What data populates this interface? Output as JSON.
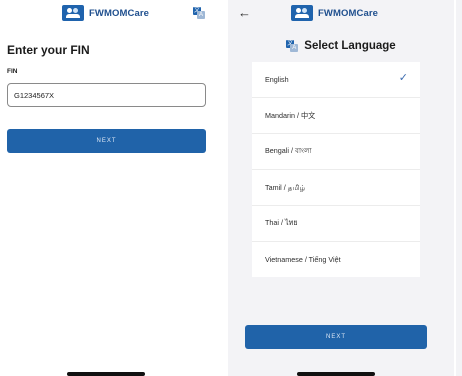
{
  "app": {
    "name": "FWMOMCare"
  },
  "fin_screen": {
    "title": "Enter your FIN",
    "field_label": "FIN",
    "fin_value": "G1234567X",
    "next_label": "NEXT"
  },
  "language_screen": {
    "title": "Select Language",
    "languages": [
      {
        "label": "English",
        "selected": true
      },
      {
        "label": "Mandarin / 中文",
        "selected": false
      },
      {
        "label": "Bengali / বাংলা",
        "selected": false
      },
      {
        "label": "Tamil / தமிழ்",
        "selected": false
      },
      {
        "label": "Thai / ไทย",
        "selected": false
      },
      {
        "label": "Vietnamese / Tiếng Việt",
        "selected": false
      }
    ],
    "next_label": "NEXT"
  },
  "icons": {
    "logo": "fwmomcare-logo-icon",
    "translate": "translate-icon",
    "back": "back-arrow-icon",
    "selected": "checkmark-icon"
  },
  "colors": {
    "brand": "#1f63ad",
    "button": "#2063a9",
    "check": "#3f6db0",
    "panel_bg": "#f3f3f6"
  }
}
